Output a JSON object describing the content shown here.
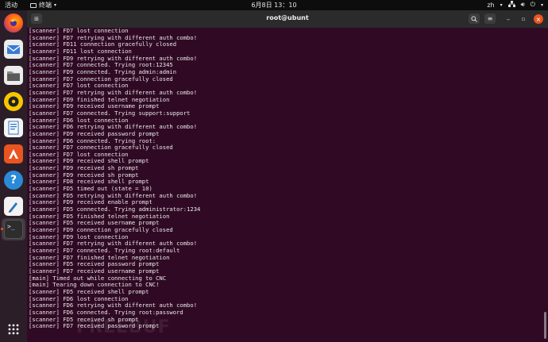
{
  "topbar": {
    "activities": "活动",
    "app_menu": "终端",
    "clock": "6月8日  13：10",
    "input_method": "zh"
  },
  "dock": {
    "items": [
      {
        "name": "Firefox",
        "icon": "firefox-icon"
      },
      {
        "name": "Thunderbird",
        "icon": "mail-icon"
      },
      {
        "name": "Files",
        "icon": "files-icon"
      },
      {
        "name": "Rhythmbox",
        "icon": "music-icon"
      },
      {
        "name": "LibreOffice Writer",
        "icon": "document-icon"
      },
      {
        "name": "Ubuntu Software",
        "icon": "software-icon"
      },
      {
        "name": "Help",
        "icon": "help-icon"
      },
      {
        "name": "Text Editor",
        "icon": "editor-icon"
      },
      {
        "name": "Terminal",
        "icon": "terminal-icon"
      },
      {
        "name": "Show Applications",
        "icon": "app-grid-icon"
      }
    ]
  },
  "window": {
    "title": "root@ubunt"
  },
  "terminal": {
    "lines": [
      "[scanner] FD7 lost connection",
      "[scanner] FD7 retrying with different auth combo!",
      "[scanner] FD11 connection gracefully closed",
      "[scanner] FD11 lost connection",
      "[scanner] FD9 retrying with different auth combo!",
      "[scanner] FD7 connected. Trying root:12345",
      "[scanner] FD9 connected. Trying admin:admin",
      "[scanner] FD7 connection gracefully closed",
      "[scanner] FD7 lost connection",
      "[scanner] FD7 retrying with different auth combo!",
      "[scanner] FD9 finished telnet negotiation",
      "[scanner] FD9 received username prompt",
      "[scanner] FD7 connected. Trying support:support",
      "[scanner] FD6 lost connection",
      "[scanner] FD6 retrying with different auth combo!",
      "[scanner] FD9 received password prompt",
      "[scanner] FD6 connected. Trying root:",
      "[scanner] FD7 connection gracefully closed",
      "[scanner] FD7 lost connection",
      "[scanner] FD9 received shell prompt",
      "[scanner] FD9 received sh prompt",
      "[scanner] FD9 received sh prompt",
      "[scanner] FD8 received shell prompt",
      "[scanner] FD5 timed out (state = 10)",
      "[scanner] FD5 retrying with different auth combo!",
      "[scanner] FD9 received enable prompt",
      "[scanner] FD5 connected. Trying administrator:1234",
      "[scanner] FD5 finished telnet negotiation",
      "[scanner] FD5 received username prompt",
      "[scanner] FD9 connection gracefully closed",
      "[scanner] FD9 lost connection",
      "[scanner] FD7 retrying with different auth combo!",
      "[scanner] FD7 connected. Trying root:default",
      "[scanner] FD7 finished telnet negotiation",
      "[scanner] FD5 received password prompt",
      "[scanner] FD7 received username prompt",
      "[main] Timed out while connecting to CNC",
      "[main] Tearing down connection to CNC!",
      "[scanner] FD5 received shell prompt",
      "[scanner] FD6 lost connection",
      "[scanner] FD6 retrying with different auth combo!",
      "[scanner] FD6 connected. Trying root:password",
      "[scanner] FD5 received sh prompt",
      "[scanner] FD7 received password prompt"
    ]
  },
  "watermark": "FREEBUF",
  "colors": {
    "terminal_bg": "#300a24",
    "accent": "#e95420"
  }
}
